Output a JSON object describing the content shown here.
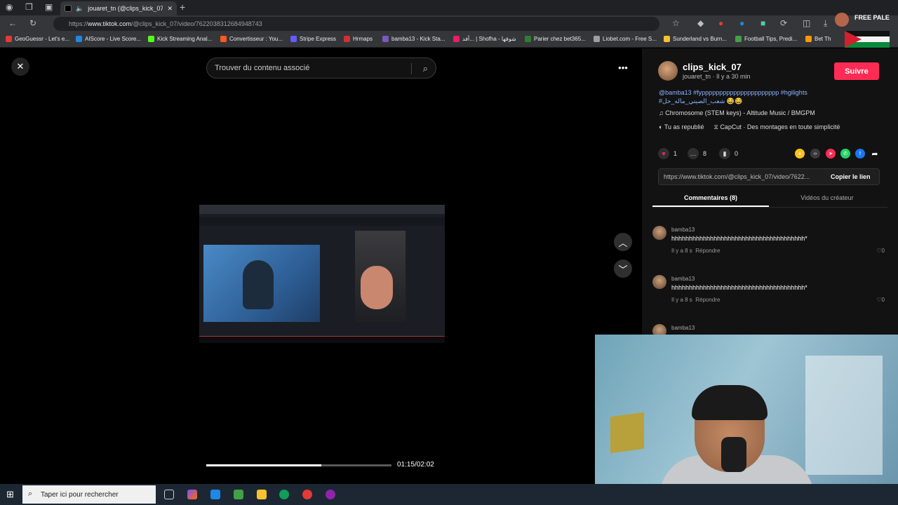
{
  "browser": {
    "tab_title": "jouaret_tn (@clips_kick_07)",
    "url_prefix": "https://",
    "url_domain": "www.tiktok.com",
    "url_path": "/@clips_kick_07/video/7622038312684948743",
    "bookmarks": [
      {
        "label": "GeoGuessr - Let's e...",
        "color": "#e53935"
      },
      {
        "label": "AIScore - Live Score...",
        "color": "#1e88e5"
      },
      {
        "label": "Kick Streaming Anal...",
        "color": "#53fc18"
      },
      {
        "label": "Convertisseur : You...",
        "color": "#ff5722"
      },
      {
        "label": "Stripe Express",
        "color": "#635bff"
      },
      {
        "label": "Hrmaps",
        "color": "#d32f2f"
      },
      {
        "label": "bamba13 - Kick Sta...",
        "color": "#7e57c2"
      },
      {
        "label": "أفد... | Shofha - شوفها",
        "color": "#e91e63"
      },
      {
        "label": "Parier chez bet365...",
        "color": "#2e7d32"
      },
      {
        "label": "Liobet.com - Free S...",
        "color": "#9e9e9e"
      },
      {
        "label": "Sunderland vs Burn...",
        "color": "#fbc02d"
      },
      {
        "label": "Football Tips, Predi...",
        "color": "#43a047"
      },
      {
        "label": "Bet Th",
        "color": "#ff9800"
      }
    ],
    "flag_text": "FREE PALESTINE"
  },
  "video": {
    "search_placeholder": "Trouver du contenu associé",
    "timecode": "01:15/02:02",
    "progress": 0.62
  },
  "creator": {
    "username": "clips_kick_07",
    "subline": "jouaret_tn · Il y a 30 min",
    "follow_label": "Suivre",
    "description": "@bamba13 #fypppppppppppppppppppppp #hgilights #شعب_الصيني_ماله_حل 😂😂",
    "music": "Chromosome (STEM keys) - Altitude Music / BMGPM",
    "reposted": "Tu as republié",
    "capcut": "CapCut · Des montages en toute simplicité"
  },
  "stats": {
    "likes": "1",
    "comments": "8",
    "saves": "0"
  },
  "share_colors": [
    "#f9c21c",
    "#3a3a3a",
    "#fe2c55",
    "#25d366",
    "#1877f2",
    "#2f2f2f"
  ],
  "link": {
    "url": "https://www.tiktok.com/@clips_kick_07/video/7622...",
    "copy_label": "Copier le lien"
  },
  "tabs": {
    "comments": "Commentaires (8)",
    "videos": "Vidéos du créateur"
  },
  "comments": [
    {
      "user": "bamba13",
      "text": "hhhhhhhhhhhhhhhhhhhhhhhhhhhhhhhhhhhhhh*",
      "time": "Il y a 8 s",
      "reply": "Répondre",
      "likes": "0"
    },
    {
      "user": "bamba13",
      "text": "hhhhhhhhhhhhhhhhhhhhhhhhhhhhhhhhhhhhhh*",
      "time": "Il y a 8 s",
      "reply": "Répondre",
      "likes": "0"
    },
    {
      "user": "bamba13",
      "text": "",
      "time": "",
      "reply": "",
      "likes": ""
    }
  ],
  "taskbar": {
    "search_placeholder": "Taper ici pour rechercher"
  }
}
